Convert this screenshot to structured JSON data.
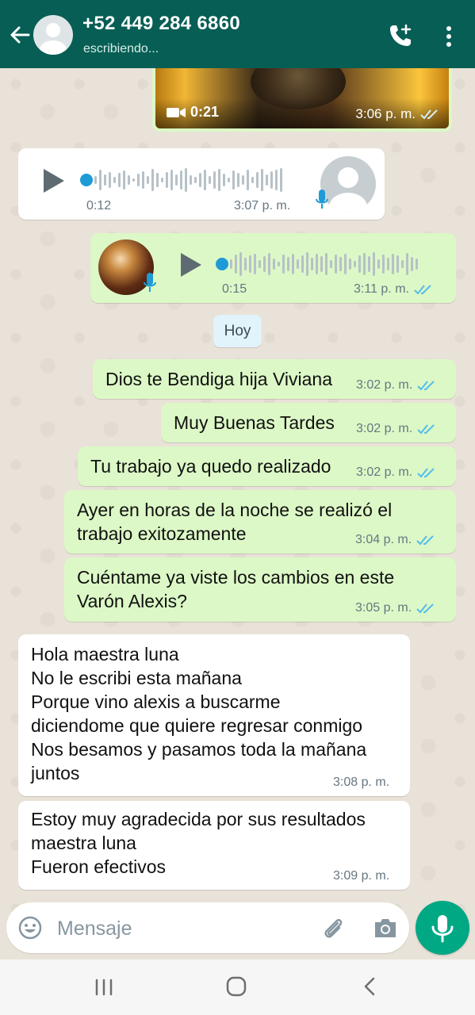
{
  "header": {
    "contact": "+52 449 284 6860",
    "status": "escribiendo..."
  },
  "video_message": {
    "duration": "0:21",
    "time": "3:06 p. m."
  },
  "voice_in": {
    "duration": "0:12",
    "time": "3:07 p. m."
  },
  "voice_out": {
    "duration": "0:15",
    "time": "3:11 p. m."
  },
  "date_chip": "Hoy",
  "outgoing": [
    {
      "lines": [
        "Dios te Bendiga hija Viviana"
      ],
      "time": "3:02 p. m."
    },
    {
      "lines": [
        "Muy Buenas Tardes"
      ],
      "time": "3:02 p. m."
    },
    {
      "lines": [
        "Tu trabajo ya quedo realizado"
      ],
      "time": "3:02 p. m."
    },
    {
      "lines": [
        "Ayer en horas de la noche se realizó el",
        "trabajo exitozamente"
      ],
      "time": "3:04 p. m."
    },
    {
      "lines": [
        "Cuéntame ya viste los cambios en este",
        "Varón Alexis?"
      ],
      "time": "3:05 p. m."
    }
  ],
  "incoming": [
    {
      "lines": [
        "Hola maestra luna",
        "No le escribi esta mañana",
        "Porque vino alexis a buscarme",
        "diciendome que quiere regresar conmigo",
        "Nos besamos y pasamos toda la mañana",
        "juntos"
      ],
      "time": "3:08 p. m."
    },
    {
      "lines": [
        "Estoy muy agradecida por sus resultados",
        "maestra luna",
        "Fueron efectivos"
      ],
      "time": "3:09 p. m."
    }
  ],
  "composer": {
    "placeholder": "Mensaje"
  },
  "colors": {
    "header": "#075e54",
    "outgoing_bubble": "#dcf8c6",
    "read_ticks": "#53bdeb",
    "send_button": "#00a884"
  }
}
